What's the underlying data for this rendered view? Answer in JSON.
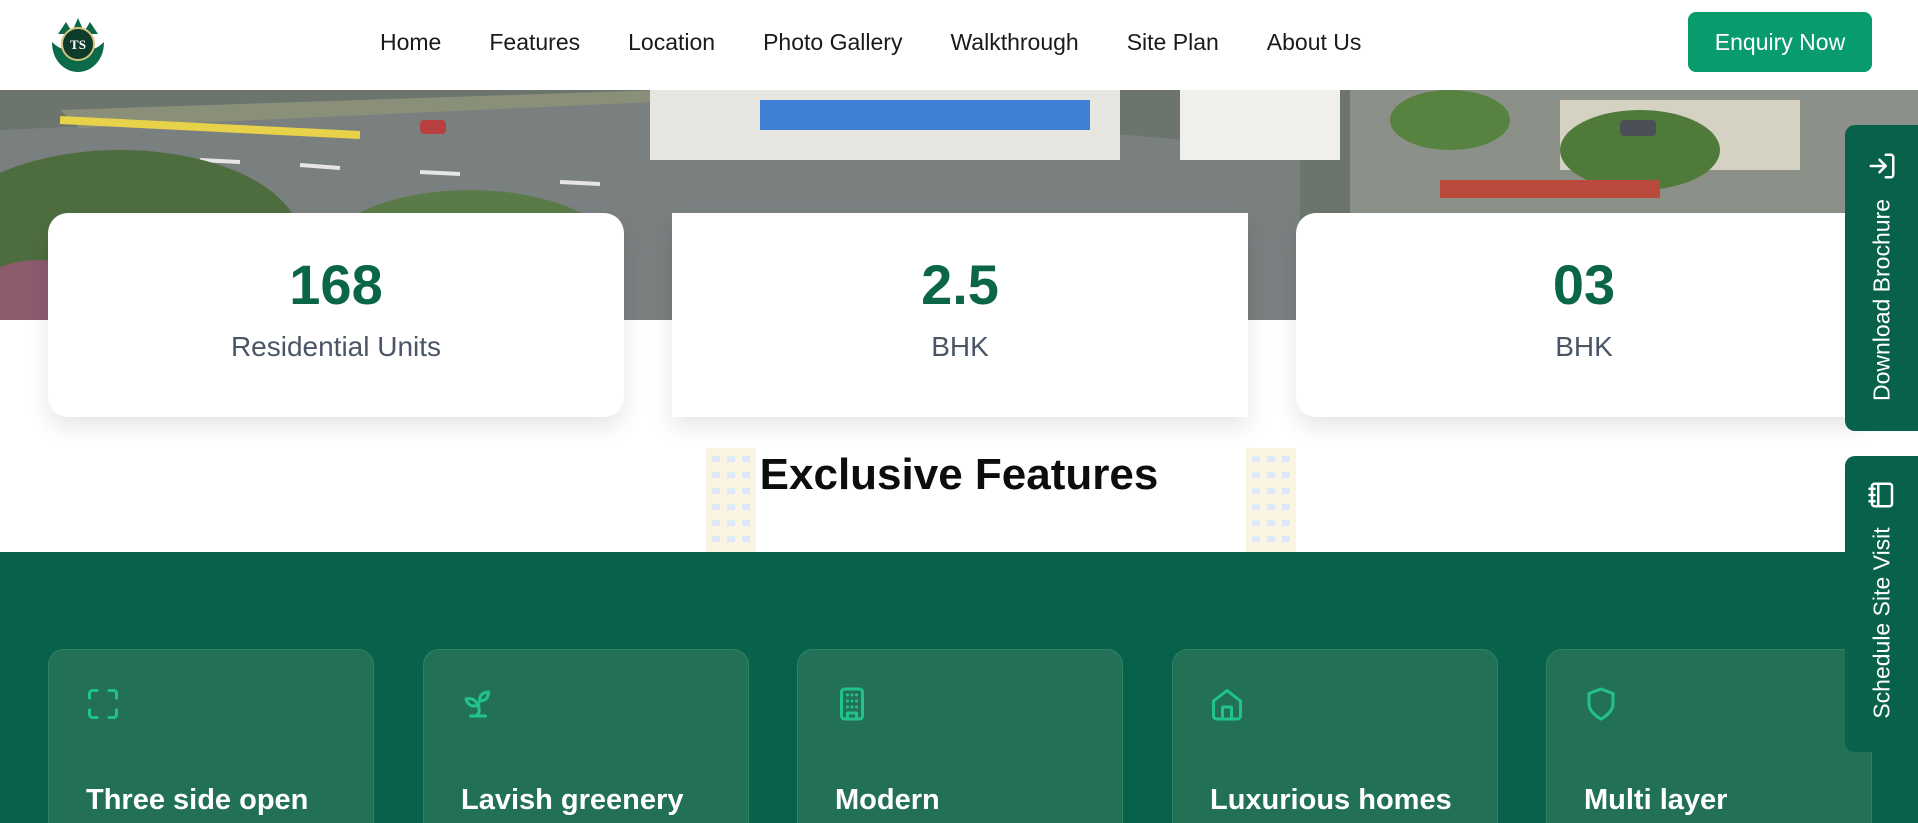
{
  "brand": {
    "logo_initials": "TS"
  },
  "nav": {
    "items": [
      {
        "label": "Home"
      },
      {
        "label": "Features"
      },
      {
        "label": "Location"
      },
      {
        "label": "Photo Gallery"
      },
      {
        "label": "Walkthrough"
      },
      {
        "label": "Site Plan"
      },
      {
        "label": "About Us"
      }
    ],
    "cta_label": "Enquiry Now"
  },
  "stats": [
    {
      "value": "168",
      "label": "Residential Units"
    },
    {
      "value": "2.5",
      "label": "BHK"
    },
    {
      "value": "03",
      "label": "BHK"
    }
  ],
  "features_section": {
    "title": "Exclusive Features",
    "cards": [
      {
        "title": "Three side open",
        "icon": "scan-frame-icon"
      },
      {
        "title": "Lavish greenery",
        "icon": "sprout-icon"
      },
      {
        "title": "Modern",
        "icon": "building-icon"
      },
      {
        "title": "Luxurious homes",
        "icon": "home-icon"
      },
      {
        "title": "Multi layer",
        "icon": "shield-icon"
      }
    ]
  },
  "side_tabs": {
    "brochure_label": "Download Brochure",
    "site_visit_label": "Schedule Site Visit"
  },
  "colors": {
    "brand_green": "#08614a",
    "cta_green": "#079b6d",
    "stat_value": "#0a6647",
    "feature_icon": "#22c38a"
  }
}
